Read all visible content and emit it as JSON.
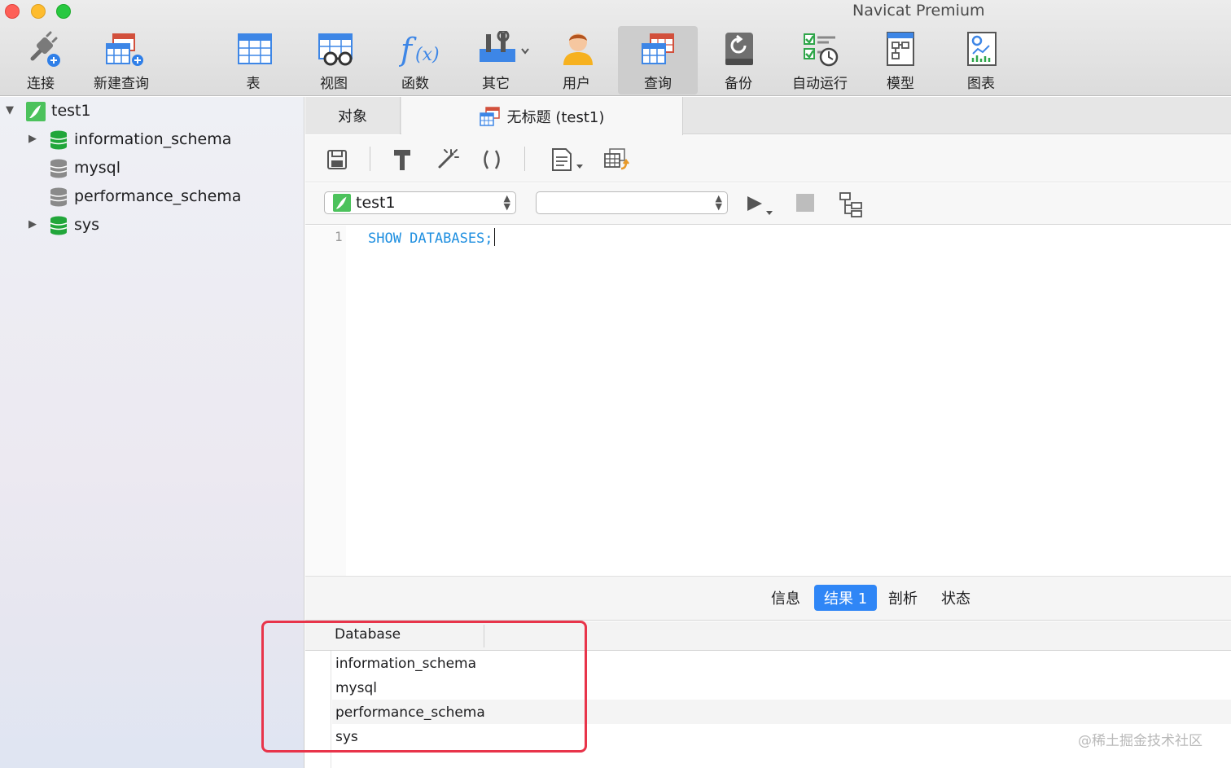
{
  "window": {
    "title": "Navicat Premium"
  },
  "toolbar": {
    "items": [
      {
        "label": "连接",
        "icon": "plug-icon"
      },
      {
        "label": "新建查询",
        "icon": "new-query-icon"
      },
      {
        "label": "表",
        "icon": "table-icon"
      },
      {
        "label": "视图",
        "icon": "view-icon"
      },
      {
        "label": "函数",
        "icon": "function-icon"
      },
      {
        "label": "其它",
        "icon": "tools-icon"
      },
      {
        "label": "用户",
        "icon": "user-icon"
      },
      {
        "label": "查询",
        "icon": "query-icon",
        "active": true
      },
      {
        "label": "备份",
        "icon": "backup-icon"
      },
      {
        "label": "自动运行",
        "icon": "automation-icon"
      },
      {
        "label": "模型",
        "icon": "model-icon"
      },
      {
        "label": "图表",
        "icon": "chart-icon"
      }
    ]
  },
  "sidebar": {
    "connection": "test1",
    "databases": [
      {
        "name": "information_schema",
        "expandable": true,
        "open": true
      },
      {
        "name": "mysql",
        "expandable": false,
        "open": false
      },
      {
        "name": "performance_schema",
        "expandable": false,
        "open": false
      },
      {
        "name": "sys",
        "expandable": true,
        "open": true
      }
    ]
  },
  "tabs": {
    "objects": "对象",
    "query": "无标题 (test1)"
  },
  "editor_toolbar": {
    "icons": [
      "save-icon",
      "format-icon",
      "beautify-icon",
      "parentheses-icon",
      "snippet-icon",
      "export-icon"
    ]
  },
  "query_bar": {
    "connection": "test1",
    "database": ""
  },
  "editor": {
    "line_number": "1",
    "code": "SHOW DATABASES;"
  },
  "result_tabs": {
    "info": "信息",
    "result": "结果 1",
    "profile": "剖析",
    "status": "状态"
  },
  "result_grid": {
    "column": "Database",
    "rows": [
      "information_schema",
      "mysql",
      "performance_schema",
      "sys"
    ]
  },
  "watermark": "@稀土掘金技术社区",
  "colors": {
    "accent": "#2f86f6",
    "highlight_border": "#e8344a",
    "sql_keyword": "#1f8fe0",
    "db_open": "#21a63a"
  }
}
